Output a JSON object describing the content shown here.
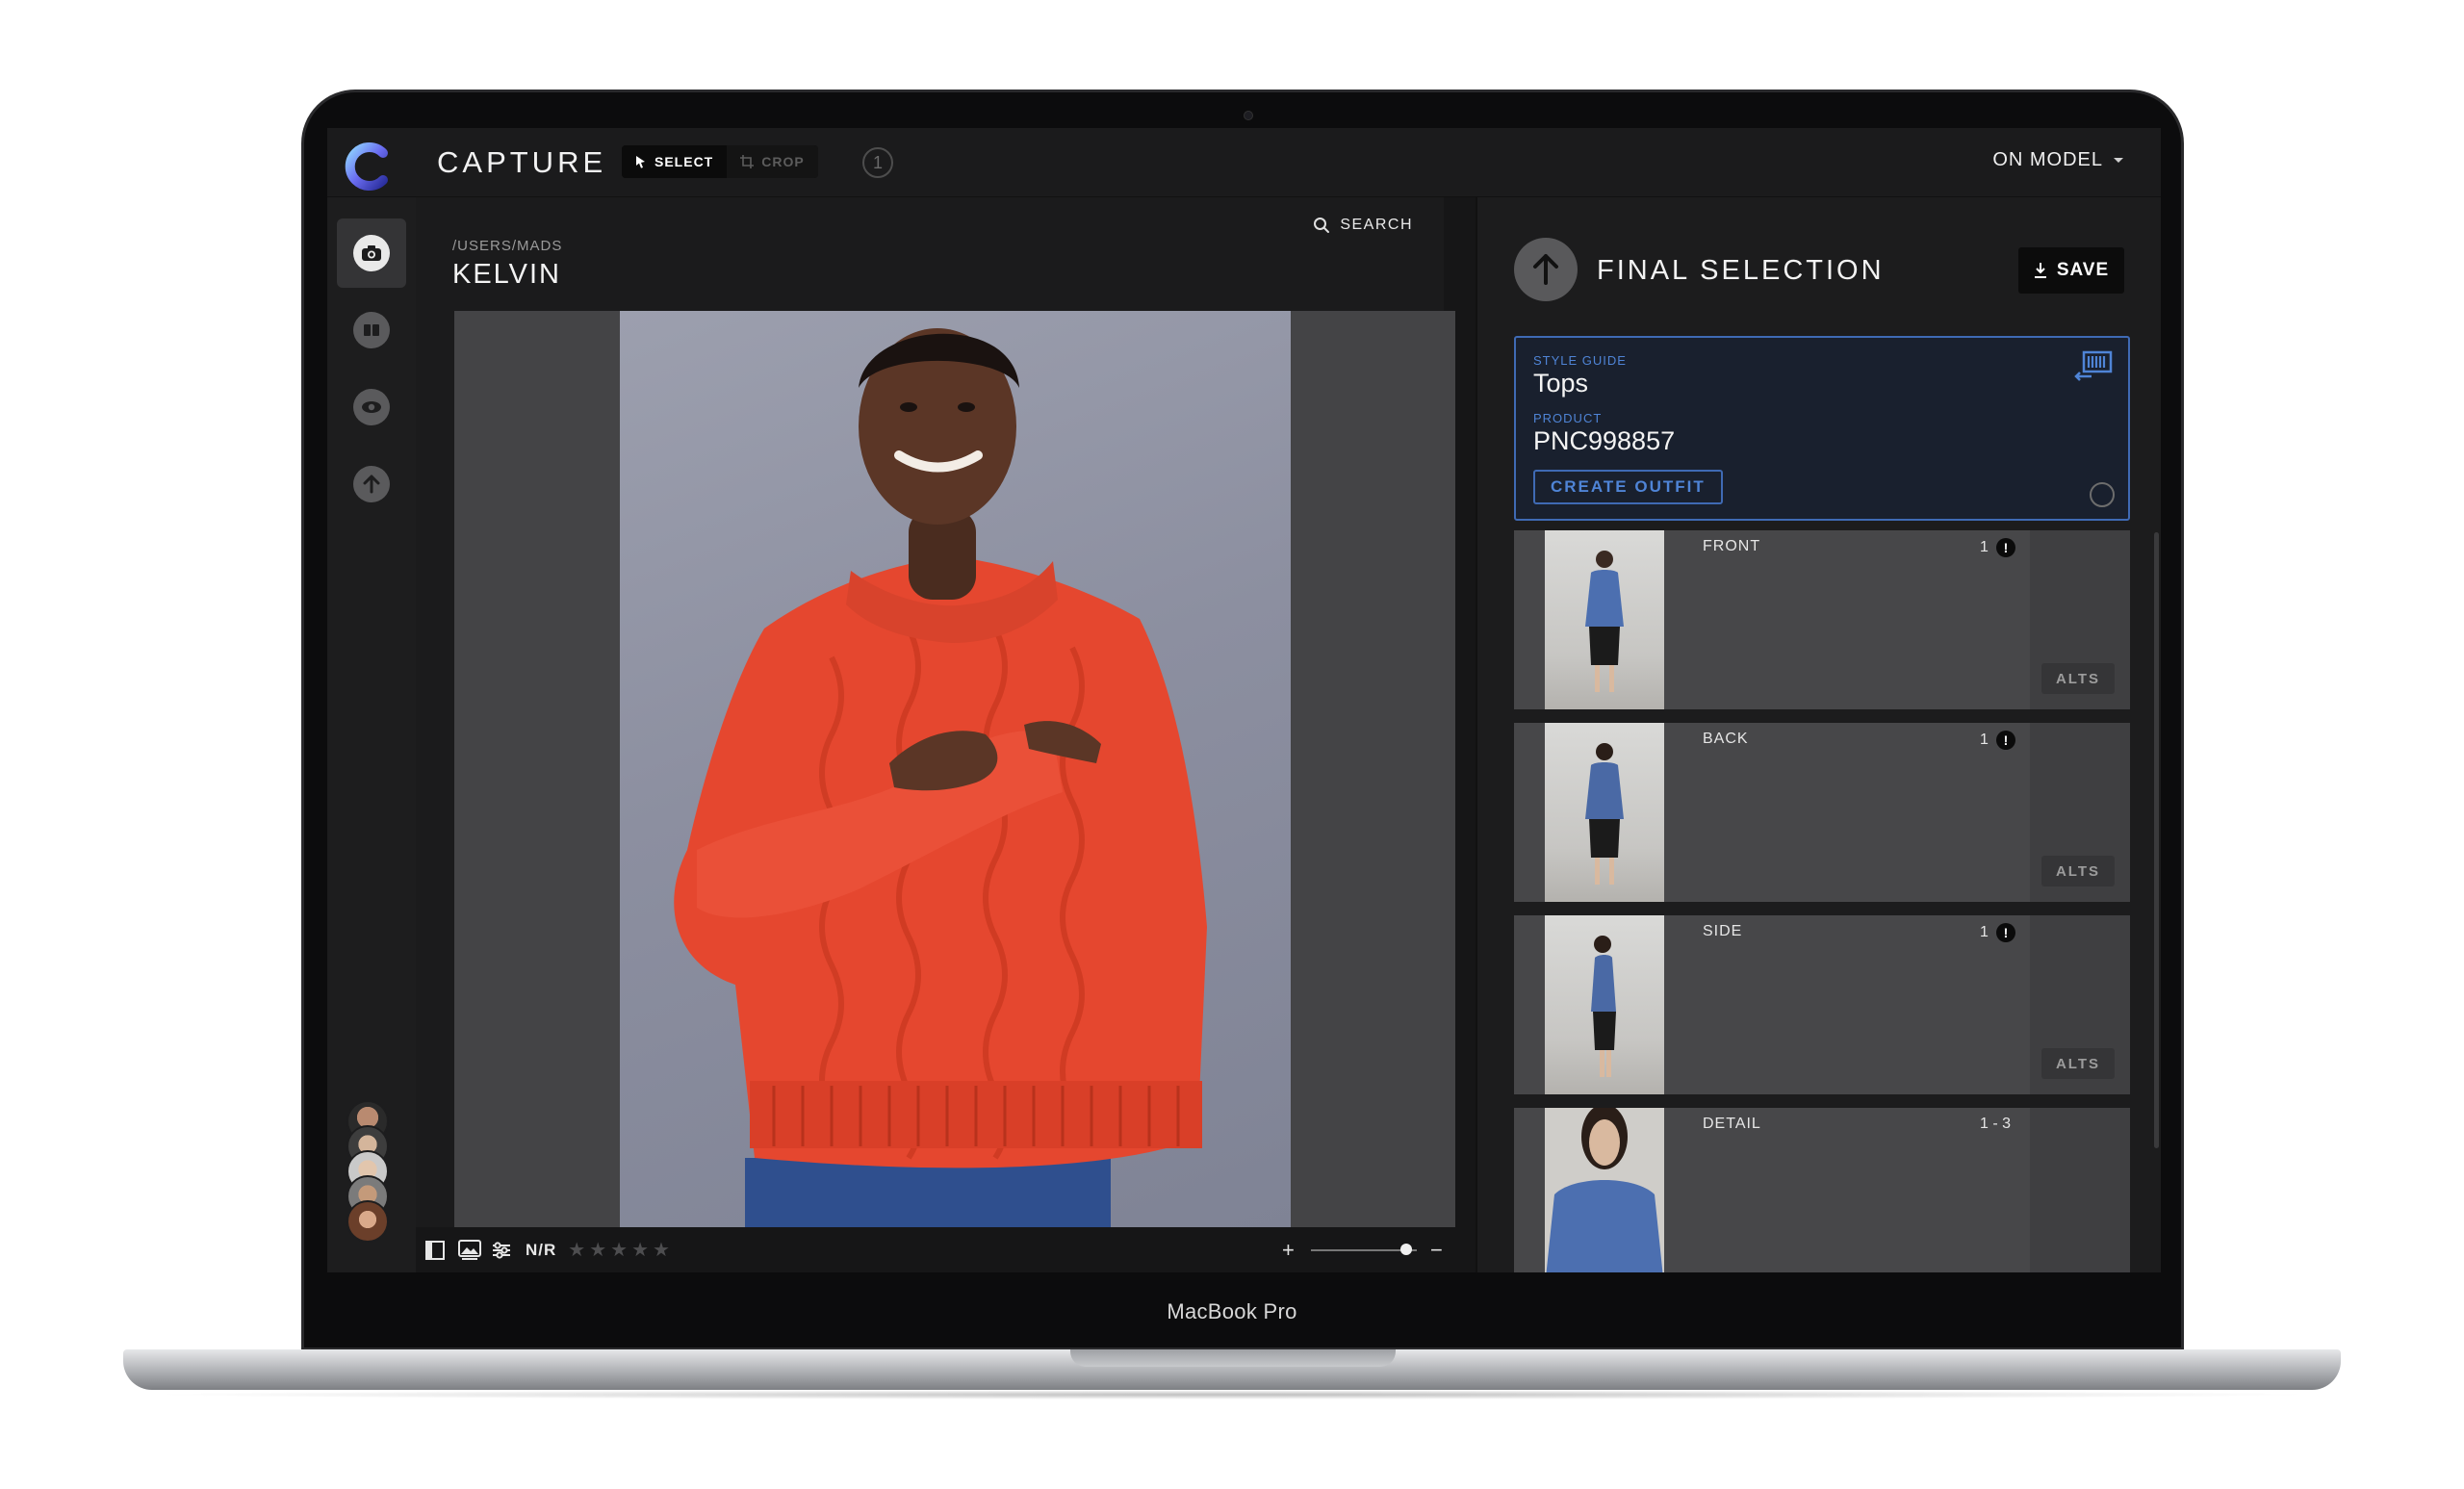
{
  "app": {
    "name": "CAPTURE",
    "device_label": "MacBook Pro"
  },
  "toolbar": {
    "select_label": "SELECT",
    "crop_label": "CROP",
    "step": "1",
    "mode_label": "ON MODEL"
  },
  "sidebar": {
    "items": [
      {
        "name": "camera",
        "active": true
      },
      {
        "name": "book",
        "active": false
      },
      {
        "name": "eye",
        "active": false
      },
      {
        "name": "upload",
        "active": false
      }
    ]
  },
  "browser": {
    "path": "/USERS/MADS",
    "title": "KELVIN",
    "search_label": "SEARCH"
  },
  "viewer_bar": {
    "rating_label": "N/R",
    "stars": [
      "★",
      "★",
      "★",
      "★",
      "★"
    ],
    "zoom_in": "+",
    "zoom_out": "−",
    "zoom_level": 0.9
  },
  "panel": {
    "title": "FINAL SELECTION",
    "save_label": "SAVE",
    "style_guide_label": "STYLE GUIDE",
    "style_guide_value": "Tops",
    "product_label": "PRODUCT",
    "product_value": "PNC998857",
    "create_outfit_label": "CREATE OUTFIT",
    "shots": [
      {
        "label": "FRONT",
        "count": "1",
        "warning": "!",
        "alts": "ALTS"
      },
      {
        "label": "BACK",
        "count": "1",
        "warning": "!",
        "alts": "ALTS"
      },
      {
        "label": "SIDE",
        "count": "1",
        "warning": "!",
        "alts": "ALTS"
      },
      {
        "label": "DETAIL",
        "count": "1 - 3",
        "warning": "",
        "alts": ""
      }
    ]
  },
  "colors": {
    "accent_blue": "#4f84d6",
    "background": "#1b1b1c",
    "sweater": "#e5472f"
  }
}
